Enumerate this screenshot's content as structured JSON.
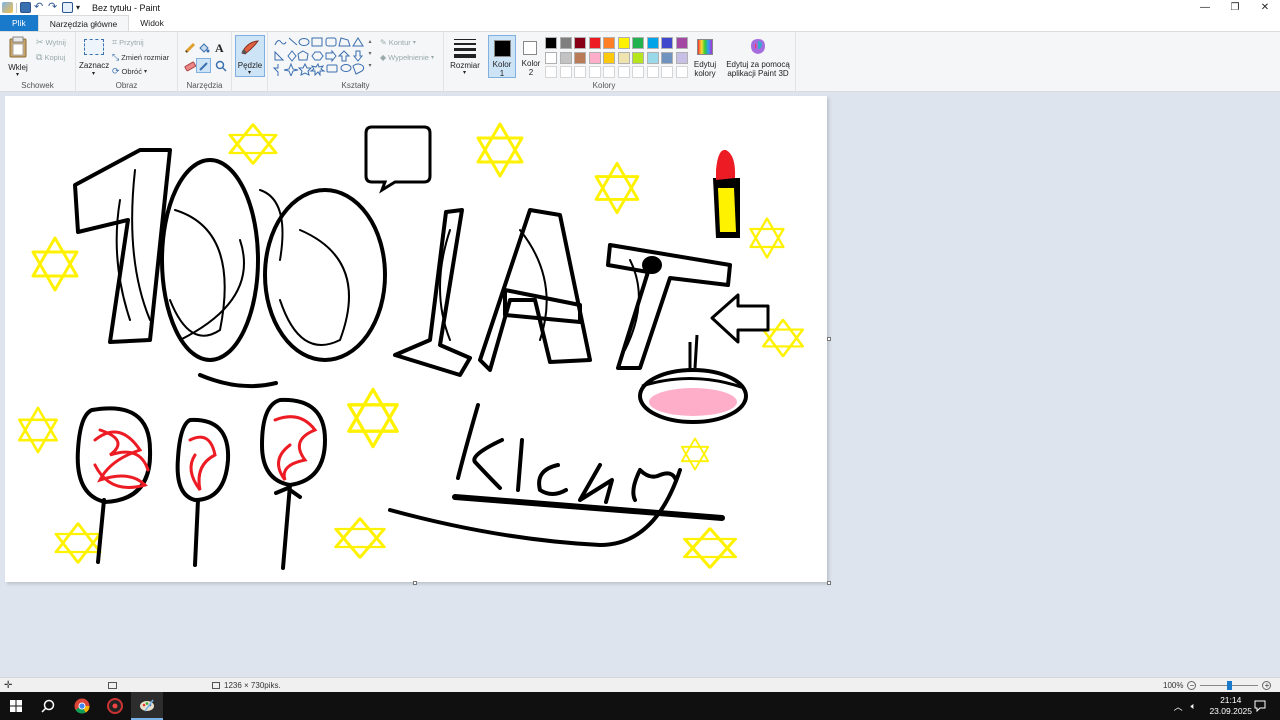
{
  "window": {
    "title": "Bez tytułu - Paint",
    "minimize": "—",
    "restore": "❐",
    "close": "✕"
  },
  "tabs": [
    {
      "label": "Plik"
    },
    {
      "label": "Narzędzia główne"
    },
    {
      "label": "Widok"
    }
  ],
  "ribbon": {
    "clipboard": {
      "label": "Schowek",
      "paste": "Wklej",
      "cut": "Wytnij",
      "copy": "Kopiuj"
    },
    "image": {
      "label": "Obraz",
      "select": "Zaznacz",
      "crop": "Przytnij",
      "resize": "Zmień rozmiar",
      "rotate": "Obróć"
    },
    "tools": {
      "label": "Narzędzia"
    },
    "brushes": {
      "label": "Pędzle"
    },
    "shapes": {
      "label": "Kształty",
      "outline": "Kontur",
      "fill": "Wypełnienie"
    },
    "size": {
      "label": "Rozmiar"
    },
    "colors": {
      "label": "Kolory",
      "color1_label": "Kolor 1",
      "color2_label": "Kolor 2",
      "edit": "Edytuj kolory",
      "paint3d": "Edytuj za pomocą aplikacji Paint 3D",
      "color1": "#000000",
      "color2": "#ffffff",
      "palette_row1": [
        "#000000",
        "#7f7f7f",
        "#880015",
        "#ed1c24",
        "#ff7f27",
        "#fff200",
        "#22b14c",
        "#00a2e8",
        "#3f48cc",
        "#a349a4"
      ],
      "palette_row2": [
        "#ffffff",
        "#c3c3c3",
        "#b97a57",
        "#ffaec9",
        "#ffc90e",
        "#efe4b0",
        "#b5e61d",
        "#99d9ea",
        "#7092be",
        "#c8bfe7"
      ]
    }
  },
  "status": {
    "dimensions": "1236 × 730piks.",
    "zoom": "100%"
  },
  "taskbar": {
    "time": "21:14",
    "date": "23.09.2025"
  }
}
